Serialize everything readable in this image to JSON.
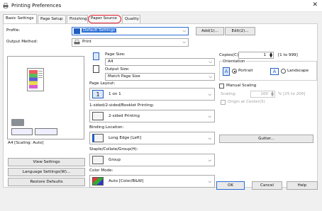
{
  "window": {
    "title": "Printing Preferences",
    "close_icon": "close-icon"
  },
  "tabs": [
    {
      "label": "Basic Settings",
      "active": true
    },
    {
      "label": "Page Setup"
    },
    {
      "label": "Finishing"
    },
    {
      "label": "Paper Source",
      "highlighted": true
    },
    {
      "label": "Quality"
    }
  ],
  "profile": {
    "label": "Profile:",
    "value": "Default Settings",
    "add_label": "Add(1)...",
    "edit_label": "Edit(2)..."
  },
  "output_method": {
    "label": "Output Method:",
    "value": "Print"
  },
  "page_size": {
    "label": "Page Size:",
    "value": "A4"
  },
  "output_size": {
    "label": "Output Size:",
    "value": "Match Page Size"
  },
  "page_layout": {
    "label": "Page Layout:",
    "value": "1 on 1",
    "icon_text": "1"
  },
  "printing": {
    "label": "1-sided/2-sided/Booklet Printing:",
    "value": "2-sided Printing"
  },
  "binding": {
    "label": "Binding Location:",
    "value": "Long Edge [Left]",
    "gutter_label": "Gutter..."
  },
  "staple": {
    "label": "Staple/Collate/Group(H):",
    "value": "Group"
  },
  "color_mode": {
    "label": "Color Mode:",
    "value": "Auto [Color/B&W]"
  },
  "copies": {
    "label": "Copies(C):",
    "value": "1",
    "range": "[1 to 999]"
  },
  "orientation": {
    "label": "Orientation",
    "portrait": "Portrait",
    "landscape": "Landscape",
    "selected": "portrait"
  },
  "manual_scaling": {
    "label": "Manual Scaling",
    "scaling_label": "Scaling:",
    "scaling_value": "100",
    "scaling_range": "% [25 to 200]",
    "origin_label": "Origin at Center(5)"
  },
  "preview": {
    "caption": "A4 [Scaling: Auto]"
  },
  "left_buttons": {
    "view": "View Settings",
    "language": "Language Settings(W)...",
    "restore": "Restore Defaults"
  },
  "footer": {
    "ok": "OK",
    "cancel": "Cancel",
    "help": "Help"
  },
  "colors": {
    "accent": "#2a6fd6",
    "highlight": "#e3202e",
    "page_icon": "#1f5fc1"
  }
}
